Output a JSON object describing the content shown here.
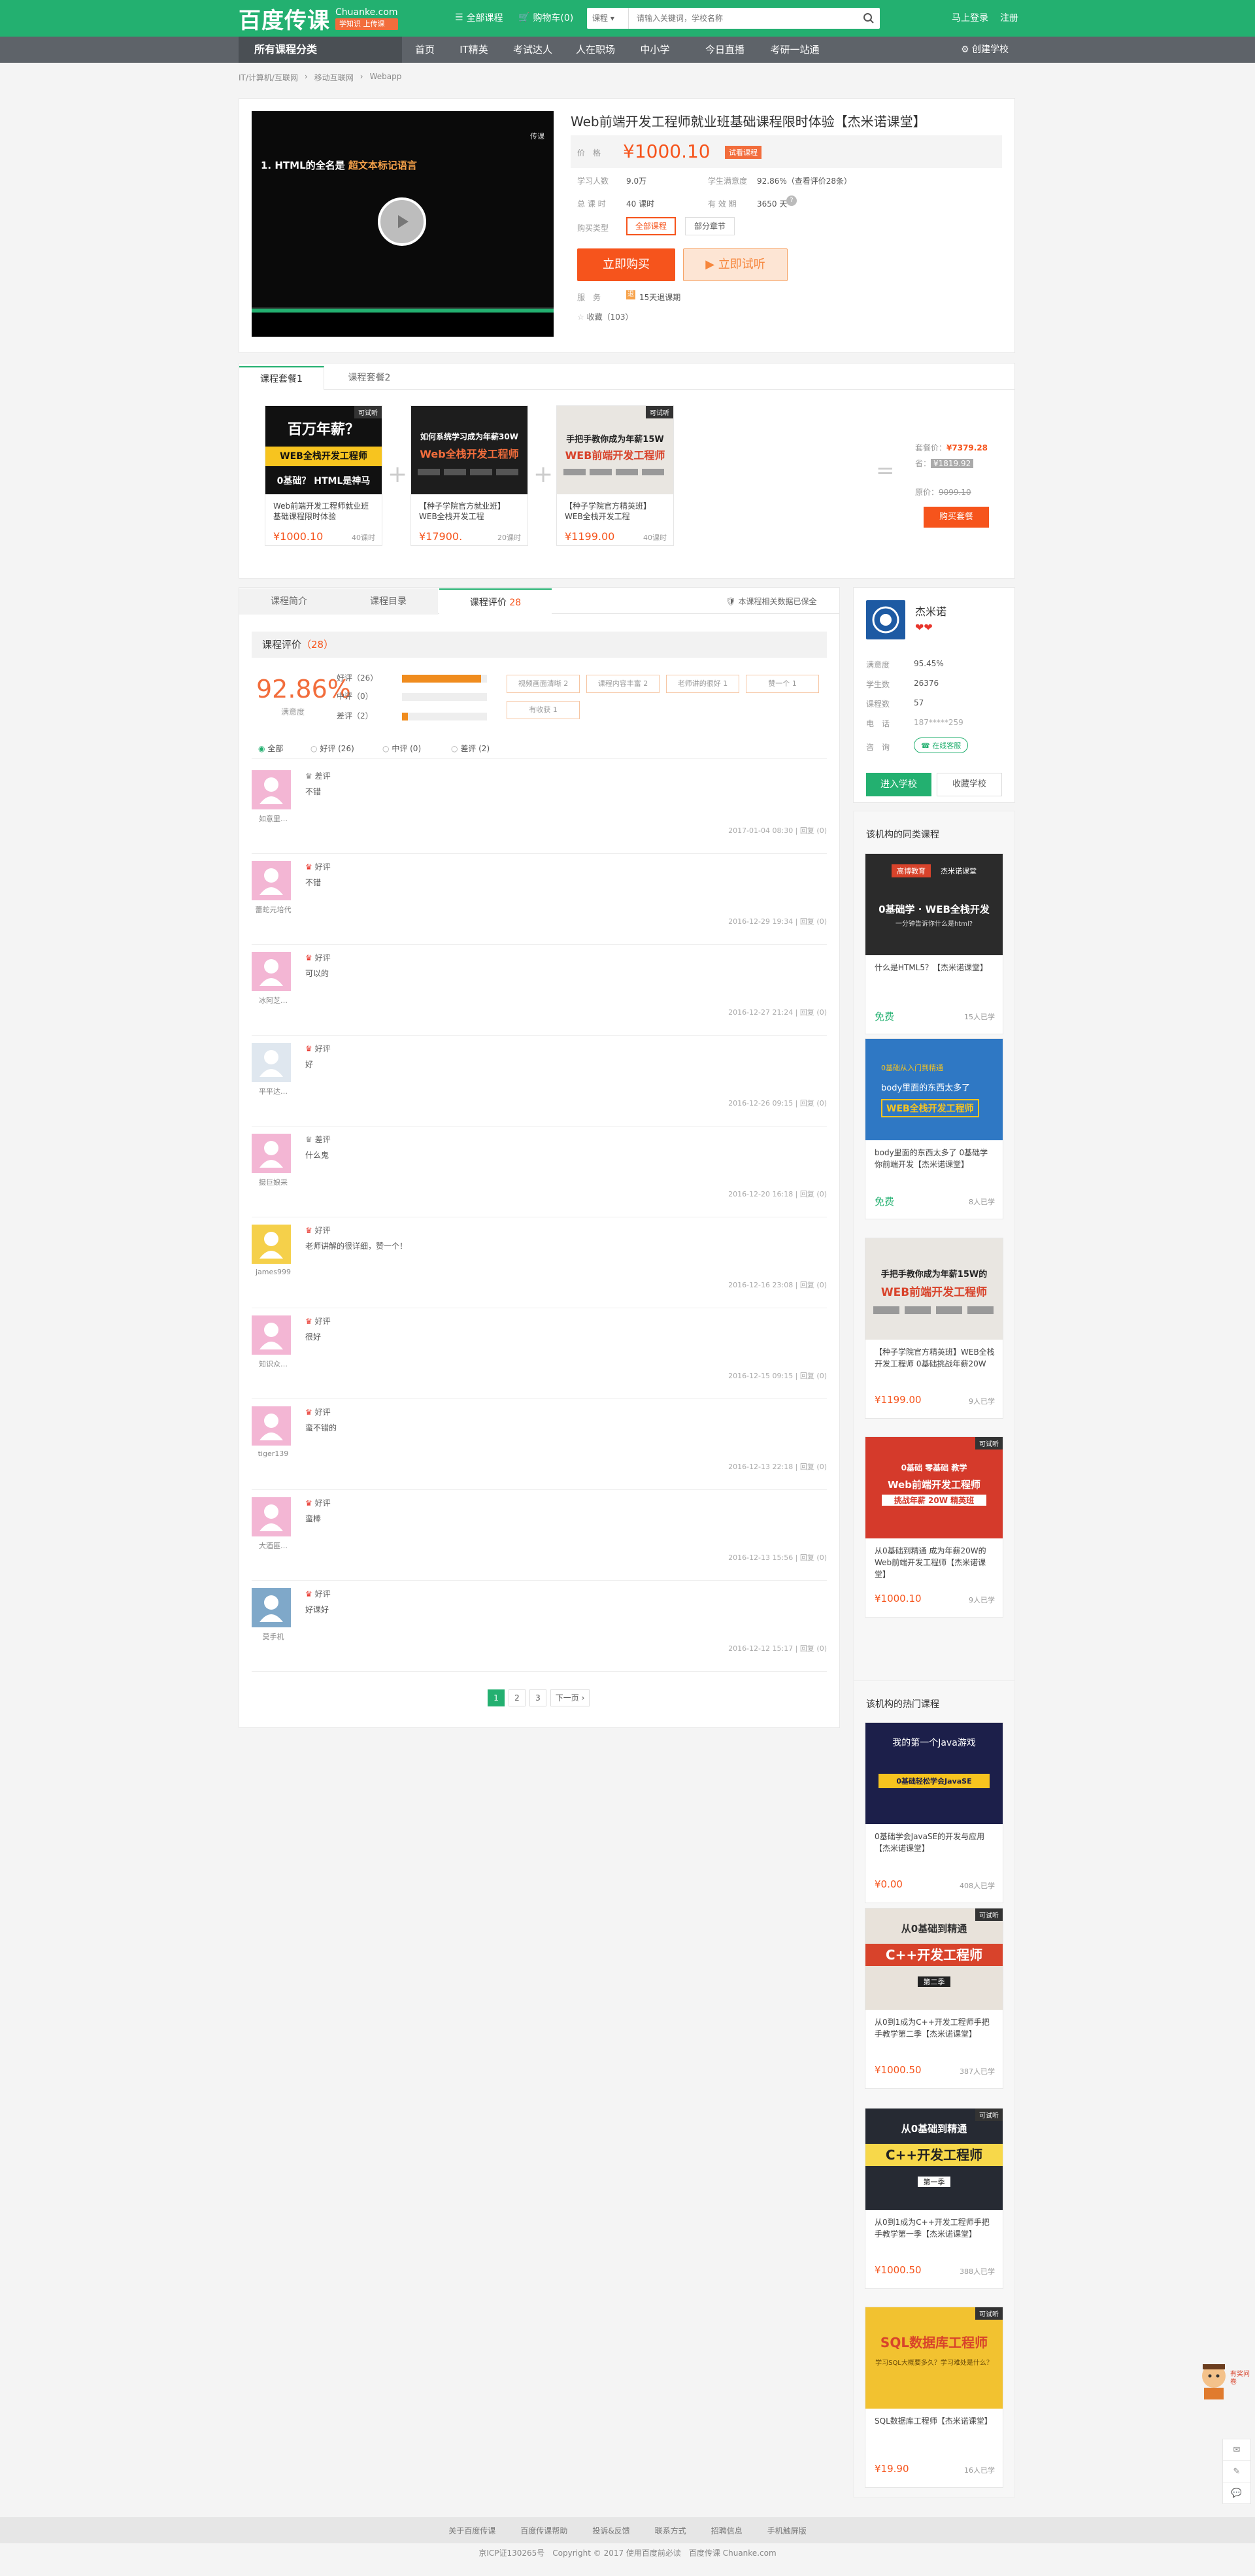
{
  "header": {
    "logo_cn": "百度传课",
    "logo_en": "Chuanke.com",
    "slogan": "学知识 上传课",
    "all_courses": "全部课程",
    "cart": "购物车(0)",
    "search_category": "课程",
    "search_placeholder": "请输入关键词，学校名称",
    "login": "马上登录",
    "register": "注册"
  },
  "nav": {
    "all_categories": "所有课程分类",
    "items": [
      "首页",
      "IT精英",
      "考试达人",
      "人在职场",
      "中小学",
      "今日直播",
      "考研一站通"
    ],
    "create_school": "创建学校"
  },
  "breadcrumb": [
    "IT/计算机/互联网",
    "移动互联网",
    "Webapp"
  ],
  "video": {
    "corner": "传课",
    "caption_prefix": "1. HTML的全名是",
    "caption_highlight": "超文本标记语言"
  },
  "course": {
    "title": "Web前端开发工程师就业班基础课程限时体验【杰米诺课堂】",
    "price_label": "价　格",
    "price": "¥1000.10",
    "badge": "试看课程",
    "students_label": "学习人数",
    "students": "9.0万",
    "satisfaction_label": "学生满意度",
    "satisfaction": "92.86%（查看评价28条）",
    "lessons_label": "总 课 时",
    "lessons": "40 课时",
    "validity_label": "有 效 期",
    "validity": "3650 天",
    "buy_type_label": "购买类型",
    "buy_type_options": [
      "全部课程",
      "部分章节"
    ],
    "buy_button": "立即购买",
    "try_button": "立即试听",
    "service_label": "服　务",
    "service": "15天退课期",
    "favorite": "收藏（103）"
  },
  "packages": {
    "tabs": [
      "课程套餐1",
      "课程套餐2"
    ],
    "items": [
      {
        "img_line1": "百万年薪？",
        "img_line2": "WEB全栈开发工程师",
        "img_line3": "0基础？ HTML是神马",
        "name": "Web前端开发工程师就业班基础课程限时体验",
        "price": "¥1000.10",
        "count": "40课时",
        "tag": "可试听"
      },
      {
        "img_line1": "如何系统学习成为年薪30W",
        "img_line2": "Web全栈开发工程师",
        "img_line3": "",
        "name": "【种子学院官方就业班】WEB全栈开发工程",
        "price": "¥17900.",
        "count": "20课时",
        "tag": ""
      },
      {
        "img_line1": "手把手教你成为年薪15W",
        "img_line2": "WEB前端开发工程师",
        "img_line3": "",
        "name": "【种子学院官方精英班】WEB全栈开发工程",
        "price": "¥1199.00",
        "count": "40课时",
        "tag": "可试听"
      }
    ],
    "equals": "=",
    "package_price_label": "套餐价：",
    "package_price": "¥7379.28",
    "save_label": "省：",
    "save": "¥1819.92",
    "original_label": "原价：",
    "original": "9099.10",
    "buy_package": "购买套餐"
  },
  "main_tabs": [
    "课程简介",
    "课程目录",
    "课程评价",
    "本课程相关数据已保全"
  ],
  "main_tab_count": "28",
  "reviews": {
    "header": "课程评价",
    "header_count": "（28）",
    "rate": "92.86%",
    "rate_label": "满意度",
    "good_label": "好评（26）",
    "mid_label": "中评（0）",
    "bad_label": "差评（2）",
    "good_ratio": 0.93,
    "mid_ratio": 0.0,
    "bad_ratio": 0.07,
    "tags": [
      "视频画面清晰 2",
      "课程内容丰富 2",
      "老师讲的很好 1",
      "赞一个 1",
      "有收获 1"
    ],
    "filters": [
      "全部",
      "好评 (26)",
      "中评 (0)",
      "差评 (2)"
    ],
    "list": [
      {
        "user": "如意里…",
        "type": "差评",
        "text": "不错",
        "time": "2017-01-04 08:30",
        "reply": "回复 (0)",
        "avatar": "pink"
      },
      {
        "user": "蕾蛇元培代",
        "type": "好评",
        "text": "不错",
        "time": "2016-12-29 19:34",
        "reply": "回复 (0)",
        "avatar": "pink"
      },
      {
        "user": "冰阿芝…",
        "type": "好评",
        "text": "可以的",
        "time": "2016-12-27 21:24",
        "reply": "回复 (0)",
        "avatar": "pink"
      },
      {
        "user": "平平达…",
        "type": "好评",
        "text": "好",
        "time": "2016-12-26 09:15",
        "reply": "回复 (0)",
        "avatar": "photo"
      },
      {
        "user": "摄巨娘采",
        "type": "差评",
        "text": "什么鬼",
        "time": "2016-12-20 16:18",
        "reply": "回复 (0)",
        "avatar": "pink"
      },
      {
        "user": "james999",
        "type": "好评",
        "text": "老师讲解的很详细，赞一个！",
        "time": "2016-12-16 23:08",
        "reply": "回复 (0)",
        "avatar": "yellow"
      },
      {
        "user": "知识众…",
        "type": "好评",
        "text": "很好",
        "time": "2016-12-15 09:15",
        "reply": "回复 (0)",
        "avatar": "pink"
      },
      {
        "user": "tiger139",
        "type": "好评",
        "text": "蛮不错的",
        "time": "2016-12-13 22:18",
        "reply": "回复 (0)",
        "avatar": "pink"
      },
      {
        "user": "大酒匪…",
        "type": "好评",
        "text": "蛮棒",
        "time": "2016-12-13 15:56",
        "reply": "回复 (0)",
        "avatar": "pink"
      },
      {
        "user": "莫手机",
        "type": "好评",
        "text": "好课好",
        "time": "2016-12-12 15:17",
        "reply": "回复 (0)",
        "avatar": "blue"
      }
    ],
    "pages": [
      "1",
      "2",
      "3",
      "下一页 ›"
    ]
  },
  "school": {
    "name": "杰米诺",
    "satisfaction_label": "满意度",
    "satisfaction": "95.45%",
    "students_label": "学生数",
    "students": "26376",
    "courses_label": "课程数",
    "courses": "57",
    "phone_label": "电　话",
    "phone": "187*****259",
    "consult_label": "咨　询",
    "consult": "在线客服",
    "enter_button": "进入学校",
    "follow_button": "收藏学校"
  },
  "same_courses": {
    "title": "该机构的同类课程",
    "items": [
      {
        "img_line1": "高博教育",
        "img_line2": "杰米诺课堂",
        "img_line3": "0基础学 · WEB全栈开发",
        "img_line4": "一分钟告诉你什么是html?",
        "name": "什么是HTML5？【杰米诺课堂】",
        "price": "免费",
        "count": "15人已学",
        "tag": ""
      },
      {
        "img_line1": "0基础从入门到精通",
        "img_line2": "body里面的东西太多了",
        "img_line3": "WEB全栈开发工程师",
        "img_line4": "",
        "name": "body里面的东西太多了 0基础学你前端开发【杰米诺课堂】",
        "price": "免费",
        "count": "8人已学",
        "tag": ""
      },
      {
        "img_line1": "手把手教你成为年薪15W的",
        "img_line2": "WEB前端开发工程师",
        "img_line3": "",
        "img_line4": "",
        "name": "【种子学院官方精英班】WEB全栈开发工程师 0基础挑战年薪20W",
        "price": "¥1199.00",
        "count": "9人已学",
        "tag": ""
      },
      {
        "img_line1": "0基础 零基础 教学",
        "img_line2": "Web前端开发工程师",
        "img_line3": "挑战年薪 20W 精英班",
        "img_line4": "",
        "name": "从0基础到精通 成为年薪20W的Web前端开发工程师【杰米诺课堂】",
        "price": "¥1000.10",
        "count": "9人已学",
        "tag": "可试听"
      }
    ]
  },
  "hot_courses": {
    "title": "该机构的热门课程",
    "items": [
      {
        "img_line1": "我的第一个Java游戏",
        "img_line2": "0基础轻松学会JavaSE",
        "name": "0基础学会JavaSE的开发与应用【杰米诺课堂】",
        "price": "¥0.00",
        "count": "408人已学",
        "tag": ""
      },
      {
        "img_line1": "从0基础到精通",
        "img_line2": "C++开发工程师",
        "img_line3": "第二季",
        "name": "从0到1成为C++开发工程师手把手教学第二季【杰米诺课堂】",
        "price": "¥1000.50",
        "count": "387人已学",
        "tag": "可试听"
      },
      {
        "img_line1": "从0基础到精通",
        "img_line2": "C++开发工程师",
        "img_line3": "第一季",
        "name": "从0到1成为C++开发工程师手把手教学第一季【杰米诺课堂】",
        "price": "¥1000.50",
        "count": "388人已学",
        "tag": "可试听"
      },
      {
        "img_line1": "SQL数据库工程师",
        "img_line2": "学习SQL大概要多久？学习难处是什么？",
        "img_line3": "",
        "name": "SQL数据库工程师【杰米诺课堂】",
        "price": "¥19.90",
        "count": "16人已学",
        "tag": "可试听"
      }
    ]
  },
  "footer": {
    "links": [
      "关于百度传课",
      "百度传课帮助",
      "投诉&反馈",
      "联系方式",
      "招聘信息",
      "手机触屏版"
    ],
    "copyright": "京ICP证130265号　Copyright © 2017 使用百度前必读　百度传课 Chuanke.com"
  },
  "float": {
    "label": "有奖问卷"
  },
  "colors": {
    "brand_green": "#23b070",
    "accent_orange": "#f6541c",
    "nav_gray": "#5e6369"
  }
}
